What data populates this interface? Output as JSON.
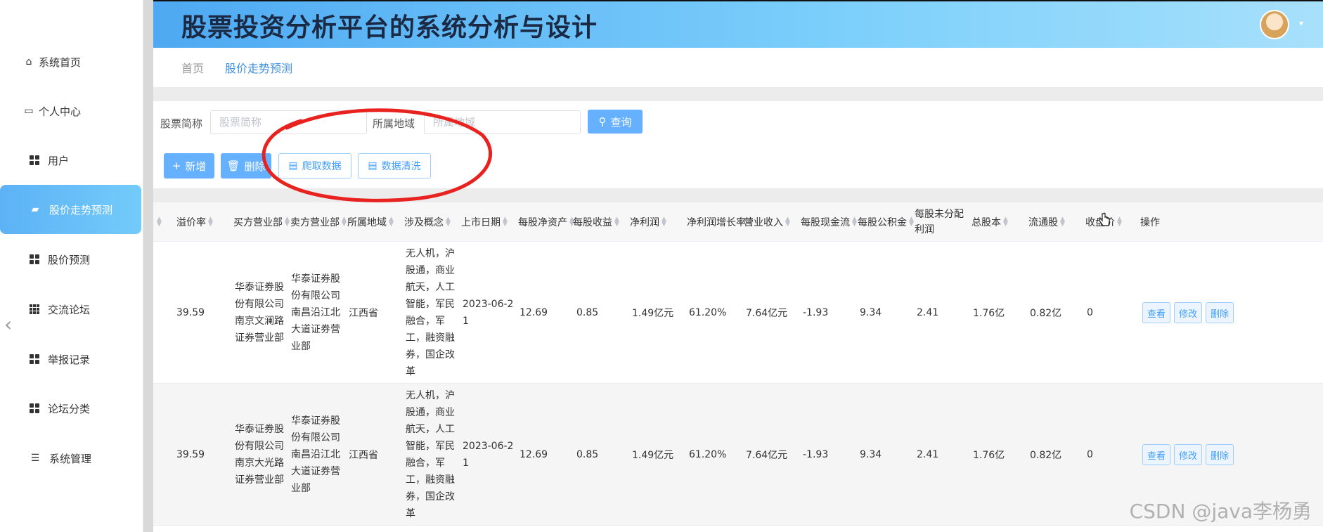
{
  "header": {
    "title": "股票投资分析平台的系统分析与设计"
  },
  "sidebar": {
    "items": [
      {
        "label": "系统首页"
      },
      {
        "label": "个人中心"
      },
      {
        "label": "用户"
      },
      {
        "label": "股价走势预测"
      },
      {
        "label": "股价预测"
      },
      {
        "label": "交流论坛"
      },
      {
        "label": "举报记录"
      },
      {
        "label": "论坛分类"
      },
      {
        "label": "系统管理"
      }
    ],
    "active_index": 3
  },
  "breadcrumb": {
    "home": "首页",
    "current": "股价走势预测"
  },
  "search": {
    "name_label": "股票简称",
    "name_placeholder": "股票简称",
    "region_label": "所属地域",
    "region_placeholder": "所属地域",
    "search_button": "查询"
  },
  "actions": {
    "add": "新增",
    "delete": "删除",
    "crawl": "爬取数据",
    "clean": "数据清洗"
  },
  "table": {
    "columns": [
      "溢价率",
      "买方营业部",
      "卖方营业部",
      "所属地域",
      "涉及概念",
      "上市日期",
      "每股净资产",
      "每股收益",
      "净利润",
      "净利润增长率",
      "营业收入",
      "每股现金流",
      "每股公积金",
      "每股未分配利润",
      "总股本",
      "流通股",
      "收盘价",
      "操作"
    ],
    "rows": [
      {
        "premium": "39.59",
        "buyer": [
          "华泰证券股",
          "份有限公司",
          "南京文澜路",
          "证券营业部"
        ],
        "seller": [
          "华泰证券股",
          "份有限公司",
          "南昌沿江北",
          "大道证券营",
          "业部"
        ],
        "region": "江西省",
        "concept": [
          "无人机，沪",
          "股通，商业",
          "航天，人工",
          "智能，军民",
          "融合，军",
          "工，融资融",
          "券，国企改",
          "革"
        ],
        "date": [
          "2023-06-2",
          "1"
        ],
        "nav": "12.69",
        "eps": "0.85",
        "profit": "1.49亿元",
        "growth": "61.20%",
        "revenue": "7.64亿元",
        "cashflow": "-1.93",
        "reserve": "9.34",
        "undistributed": "2.41",
        "total_shares": "1.76亿",
        "float_shares": "0.82亿",
        "close": "0"
      },
      {
        "premium": "39.59",
        "buyer": [
          "华泰证券股",
          "份有限公司",
          "南京大光路",
          "证券营业部"
        ],
        "seller": [
          "华泰证券股",
          "份有限公司",
          "南昌沿江北",
          "大道证券营",
          "业部"
        ],
        "region": "江西省",
        "concept": [
          "无人机，沪",
          "股通，商业",
          "航天，人工",
          "智能，军民",
          "融合，军",
          "工，融资融",
          "券，国企改",
          "革"
        ],
        "date": [
          "2023-06-2",
          "1"
        ],
        "nav": "12.69",
        "eps": "0.85",
        "profit": "1.49亿元",
        "growth": "61.20%",
        "revenue": "7.64亿元",
        "cashflow": "-1.93",
        "reserve": "9.34",
        "undistributed": "2.41",
        "total_shares": "1.76亿",
        "float_shares": "0.82亿",
        "close": "0"
      }
    ],
    "row_actions": {
      "view": "查看",
      "edit": "修改",
      "delete": "删除"
    }
  },
  "watermark": "CSDN @java李杨勇",
  "colors": {
    "accent": "#409eff",
    "button": "#66b1ff",
    "annotation": "#e8231f"
  }
}
